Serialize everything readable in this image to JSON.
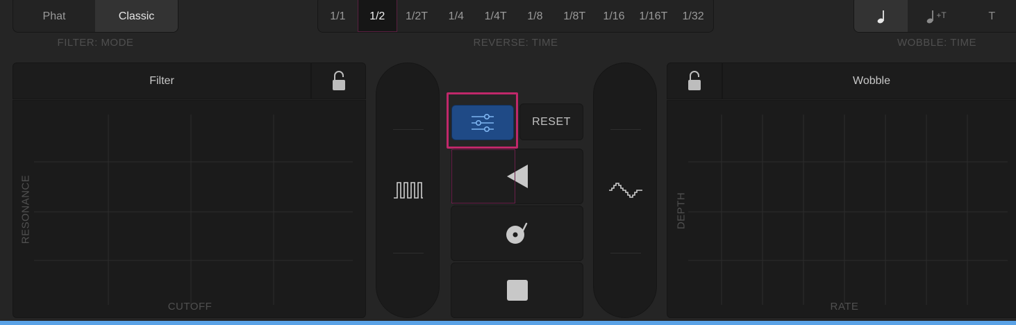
{
  "filter_mode": {
    "options": [
      "Phat",
      "Classic"
    ],
    "selected": "Classic",
    "caption": "FILTER: MODE"
  },
  "reverse_time": {
    "options": [
      "1/1",
      "1/2",
      "1/2T",
      "1/4",
      "1/4T",
      "1/8",
      "1/8T",
      "1/16",
      "1/16T",
      "1/32"
    ],
    "selected": "1/2",
    "caption": "REVERSE: TIME"
  },
  "wobble_time": {
    "options": [
      "quarter-note-icon",
      "quarter-note-triplet-icon",
      "triplet-icon"
    ],
    "triplet_suffix": "+T",
    "triplet_label": "T",
    "caption": "WOBBLE: TIME"
  },
  "filter_panel": {
    "title": "Filter",
    "x_label": "CUTOFF",
    "y_label": "RESONANCE"
  },
  "wobble_panel": {
    "title": "Wobble",
    "x_label": "RATE",
    "y_label": "DEPTH"
  },
  "center": {
    "reset_label": "RESET"
  },
  "colors": {
    "accent_blue": "#1f4a86",
    "highlight_magenta": "#c0286a",
    "bottom_bar": "#5aa2e6"
  }
}
